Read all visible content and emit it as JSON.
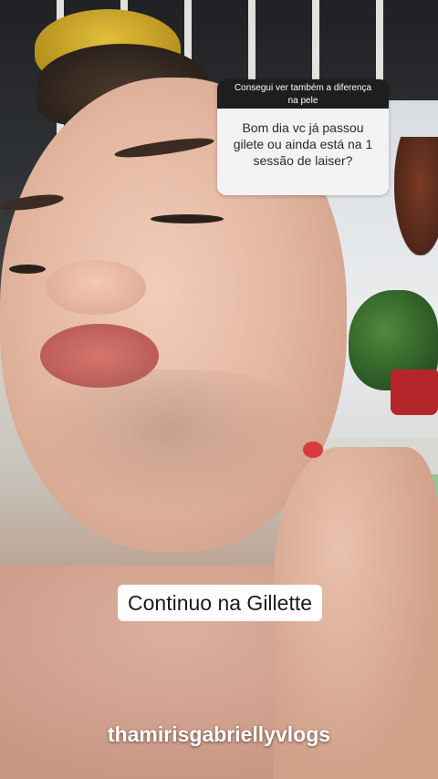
{
  "story": {
    "question_sticker": {
      "prompt": "Consegui ver também a diferença na pele",
      "question": "Bom dia vc já passou gilete ou ainda está na 1 sessão de laiser?"
    },
    "caption": "Continuo na Gillette",
    "username": "thamirisgabriellyvlogs"
  },
  "colors": {
    "sticker_header": "#1e1e1e",
    "sticker_body": "#f3f3f3",
    "caption_bg": "#ffffff",
    "nail_polish": "#d83a3f"
  }
}
